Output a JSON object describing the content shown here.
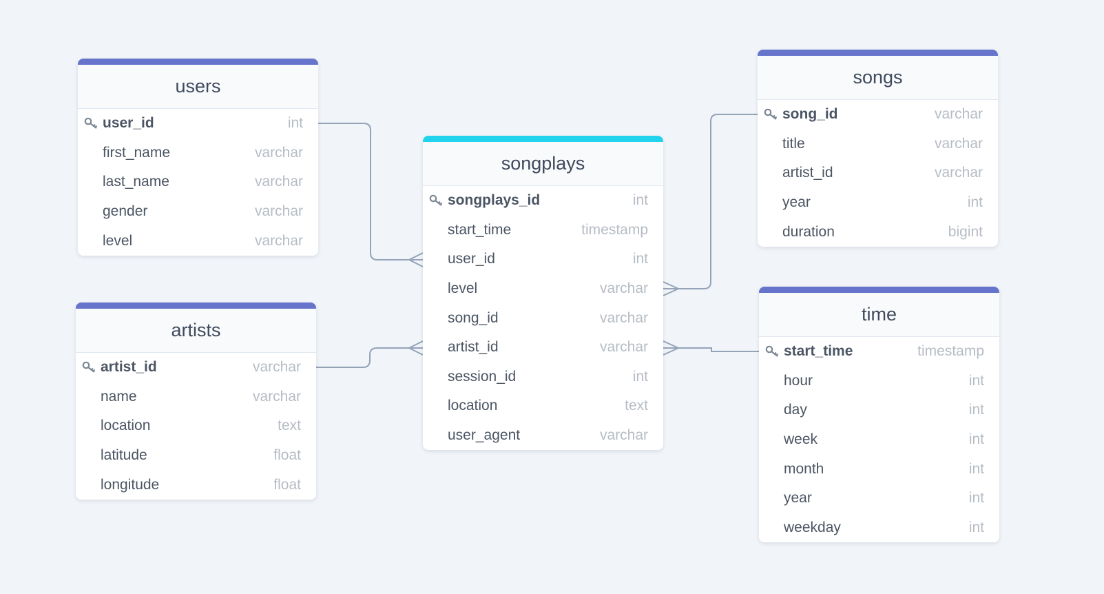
{
  "colors": {
    "table_accent": "#6674cc",
    "fact_accent": "#22d3ee",
    "link": "#94a3b8"
  },
  "tables": [
    {
      "id": "users",
      "name": "users",
      "accent": "#6674cc",
      "columns": [
        {
          "name": "user_id",
          "type": "int",
          "pk": true
        },
        {
          "name": "first_name",
          "type": "varchar"
        },
        {
          "name": "last_name",
          "type": "varchar"
        },
        {
          "name": "gender",
          "type": "varchar"
        },
        {
          "name": "level",
          "type": "varchar"
        }
      ]
    },
    {
      "id": "songs",
      "name": "songs",
      "accent": "#6674cc",
      "columns": [
        {
          "name": "song_id",
          "type": "varchar",
          "pk": true
        },
        {
          "name": "title",
          "type": "varchar"
        },
        {
          "name": "artist_id",
          "type": "varchar"
        },
        {
          "name": "year",
          "type": "int"
        },
        {
          "name": "duration",
          "type": "bigint"
        }
      ]
    },
    {
      "id": "songplays",
      "name": "songplays",
      "accent": "#22d3ee",
      "columns": [
        {
          "name": "songplays_id",
          "type": "int",
          "pk": true
        },
        {
          "name": "start_time",
          "type": "timestamp"
        },
        {
          "name": "user_id",
          "type": "int"
        },
        {
          "name": "level",
          "type": "varchar"
        },
        {
          "name": "song_id",
          "type": "varchar"
        },
        {
          "name": "artist_id",
          "type": "varchar"
        },
        {
          "name": "session_id",
          "type": "int"
        },
        {
          "name": "location",
          "type": "text"
        },
        {
          "name": "user_agent",
          "type": "varchar"
        }
      ]
    },
    {
      "id": "artists",
      "name": "artists",
      "accent": "#6674cc",
      "columns": [
        {
          "name": "artist_id",
          "type": "varchar",
          "pk": true
        },
        {
          "name": "name",
          "type": "varchar"
        },
        {
          "name": "location",
          "type": "text"
        },
        {
          "name": "latitude",
          "type": "float"
        },
        {
          "name": "longitude",
          "type": "float"
        }
      ]
    },
    {
      "id": "time",
      "name": "time",
      "accent": "#6674cc",
      "columns": [
        {
          "name": "start_time",
          "type": "timestamp",
          "pk": true
        },
        {
          "name": "hour",
          "type": "int"
        },
        {
          "name": "day",
          "type": "int"
        },
        {
          "name": "week",
          "type": "int"
        },
        {
          "name": "month",
          "type": "int"
        },
        {
          "name": "year",
          "type": "int"
        },
        {
          "name": "weekday",
          "type": "int"
        }
      ]
    }
  ],
  "relationships": [
    {
      "from": "users.user_id",
      "to": "songplays.user_id",
      "cardinality": "one-to-many"
    },
    {
      "from": "artists.artist_id",
      "to": "songplays.artist_id",
      "cardinality": "one-to-many"
    },
    {
      "from": "songs.song_id",
      "to": "songplays.level",
      "cardinality": "one-to-many"
    },
    {
      "from": "time.start_time",
      "to": "songplays.artist_id",
      "cardinality": "one-to-many"
    }
  ]
}
